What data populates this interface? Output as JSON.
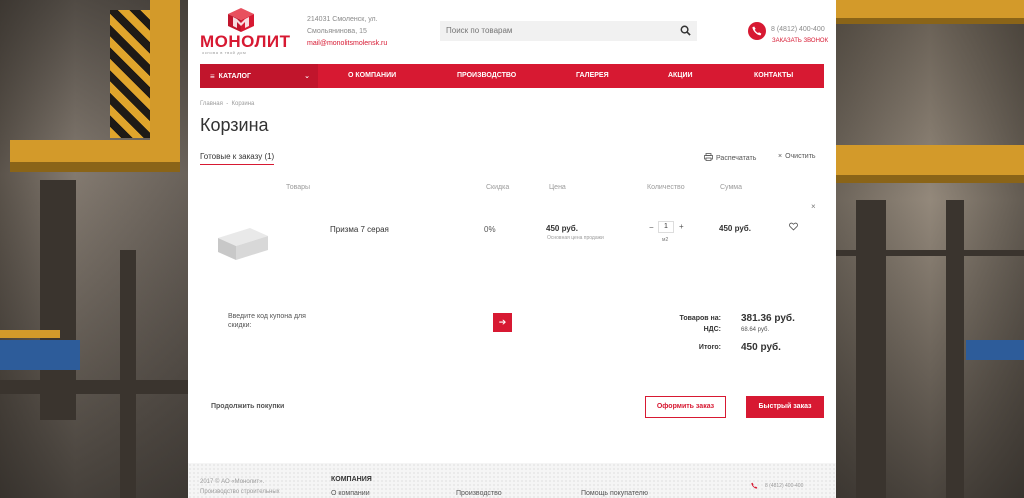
{
  "header": {
    "logo_text": "МОНОЛИТ",
    "logo_tagline": "основа в твой дом",
    "address_line1": "214031 Смоленск, ул.",
    "address_line2": "Смольянинова, 15",
    "email": "mail@monolitsmolensk.ru",
    "search_placeholder": "Поиск по товарам",
    "phone": "8 (4812) 400-400",
    "callback": "ЗАКАЗАТЬ ЗВОНОК"
  },
  "nav": {
    "catalog": "КАТАЛОГ",
    "items": [
      "О КОМПАНИИ",
      "ПРОИЗВОДСТВО",
      "ГАЛЕРЕЯ",
      "АКЦИИ",
      "КОНТАКТЫ"
    ]
  },
  "breadcrumb": {
    "home": "Главная",
    "sep": "-",
    "current": "Корзина"
  },
  "page_title": "Корзина",
  "tabs": {
    "ready": "Готовые к заказу (1)"
  },
  "actions": {
    "print": "Распечатать",
    "clear": "Очистить"
  },
  "table": {
    "headers": [
      "Товары",
      "Скидка",
      "Цена",
      "Количество",
      "Сумма"
    ],
    "rows": [
      {
        "name": "Призма 7 серая",
        "discount": "0%",
        "price": "450 руб.",
        "price_note": "Основная цена продажи",
        "qty": "1",
        "unit": "м2",
        "sum": "450 руб."
      }
    ]
  },
  "coupon": {
    "label": "Введите код купона для скидки:"
  },
  "totals": {
    "goods_label": "Товаров на:",
    "goods_value": "381.36 руб.",
    "vat_label": "НДС:",
    "vat_value": "68.64 руб.",
    "total_label": "Итого:",
    "total_value": "450 руб."
  },
  "buttons": {
    "continue": "Продолжить покупки",
    "checkout": "Оформить заказ",
    "quick": "Быстрый заказ"
  },
  "footer": {
    "copy_line1": "2017 © АО «Монолит».",
    "copy_line2": "Производство строительных",
    "heading": "КОМПАНИЯ",
    "links": [
      "О компании",
      "Производство",
      "Помощь покупателю"
    ],
    "phone": "8 (4812) 400-400"
  },
  "colors": {
    "accent": "#d71932",
    "accent_dark": "#c1152c"
  }
}
